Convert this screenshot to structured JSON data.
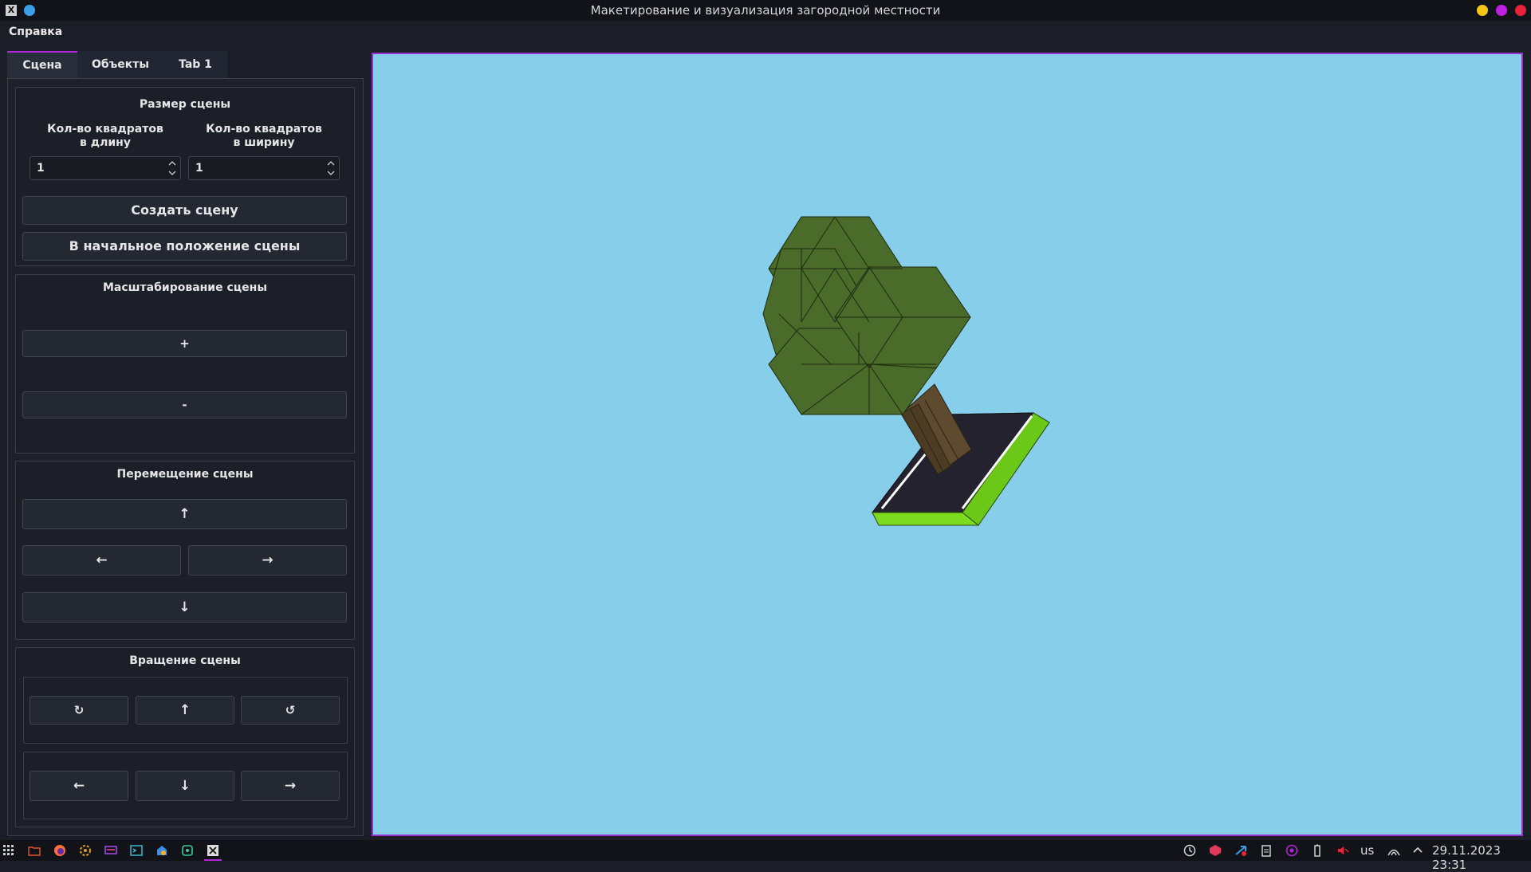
{
  "window": {
    "title": "Макетирование и визуализация загородной местности",
    "app_icon_glyph": "X"
  },
  "menu": {
    "help": "Справка"
  },
  "tabs": [
    {
      "label": "Сцена"
    },
    {
      "label": "Объекты"
    },
    {
      "label": "Tab 1"
    }
  ],
  "scene_size": {
    "title": "Размер сцены",
    "length_label": "Кол-во квадратов\nв длину",
    "length_label_1": "Кол-во квадратов",
    "length_label_2": "в длину",
    "width_label_1": "Кол-во квадратов",
    "width_label_2": "в ширину",
    "length_value": "1",
    "width_value": "1",
    "create_button": "Создать сцену",
    "reset_button": "В начальное положение сцены"
  },
  "scaling": {
    "title": "Масштабирование сцены",
    "zoom_in": "+",
    "zoom_out": "-"
  },
  "moving": {
    "title": "Перемещение сцены",
    "up": "↑",
    "left": "←",
    "right": "→",
    "down": "↓"
  },
  "rotation": {
    "title": "Вращение сцены",
    "rotate_cw": "↻",
    "tilt_up": "↑",
    "rotate_ccw": "↺",
    "turn_left": "←",
    "tilt_down": "↓",
    "turn_right": "→"
  },
  "taskbar": {
    "keyboard_layout": "us",
    "datetime": "29.11.2023  23:31"
  },
  "colors": {
    "accent": "#b026d8",
    "viewport_bg": "#87ceea",
    "foliage": "#4a6b2a",
    "trunk": "#5e4a2e",
    "ground": "#23222e",
    "grass": "#7ddc1f"
  },
  "icons": [
    "app-menu-grid-icon",
    "folder-icon",
    "firefox-icon",
    "settings-icon",
    "monitor-icon",
    "terminal-icon",
    "store-icon",
    "editor-icon",
    "app-icon",
    "clock-icon",
    "package-icon",
    "upload-icon",
    "clipboard-icon",
    "media-icon",
    "battery-icon",
    "volume-icon",
    "wifi-icon",
    "chevron-up-icon"
  ]
}
